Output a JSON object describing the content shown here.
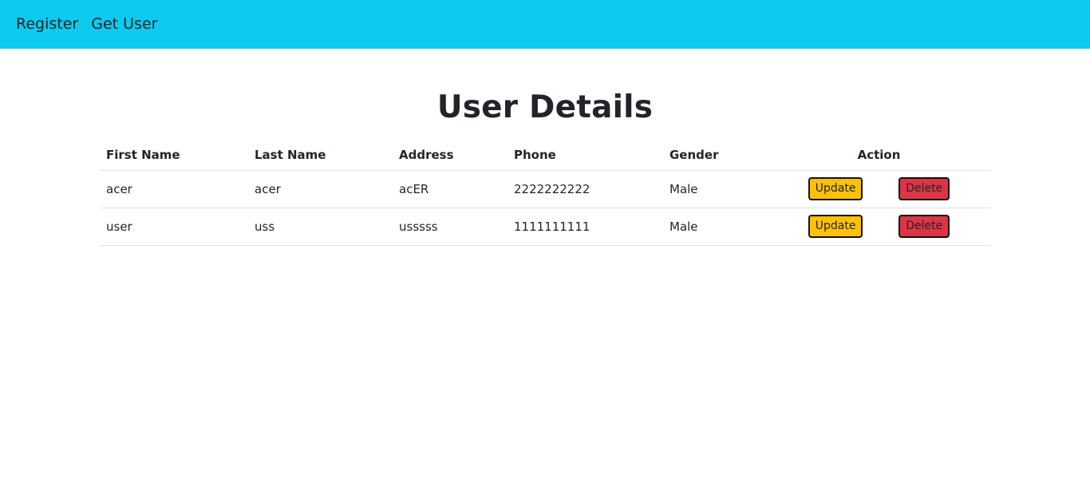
{
  "colors": {
    "navbar_bg": "#0dcaf0",
    "update_bg": "#ffc107",
    "delete_bg": "#dc3545"
  },
  "nav": {
    "links": [
      "Register",
      "Get User"
    ]
  },
  "page_title": "User Details",
  "table": {
    "headers": [
      "First Name",
      "Last Name",
      "Address",
      "Phone",
      "Gender",
      "Action"
    ],
    "rows": [
      {
        "first_name": "acer",
        "last_name": "acer",
        "address": "acER",
        "phone": "2222222222",
        "gender": "Male"
      },
      {
        "first_name": "user",
        "last_name": "uss",
        "address": "usssss",
        "phone": "1111111111",
        "gender": "Male"
      }
    ],
    "update_label": "Update",
    "delete_label": "Delete"
  }
}
